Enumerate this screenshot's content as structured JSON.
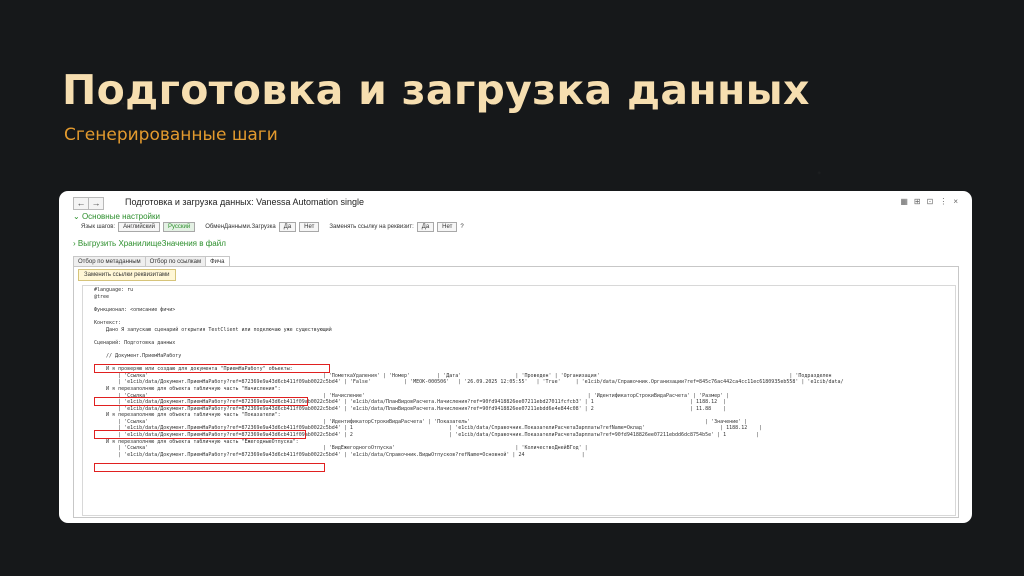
{
  "slide": {
    "title": "Подготовка и загрузка данных",
    "subtitle": "Сгенерированные шаги"
  },
  "window": {
    "title": "Подготовка и загрузка данных: Vanessa Automation single",
    "nav_back": "←",
    "nav_forward": "→",
    "icons": [
      "▦",
      "⊞",
      "⊡",
      "⋮",
      "×"
    ]
  },
  "settings": {
    "toggle": "Основные настройки",
    "lang_label": "Язык шагов:",
    "lang_en": "Английский",
    "lang_ru": "Русский",
    "exchange_label": "ОбменДанными.Загрузка",
    "yes": "Да",
    "no": "Нет",
    "replace_label": "Заменять ссылку на реквизит:",
    "help": "?"
  },
  "export_toggle": "Выгрузить ХранилищеЗначения в файл",
  "tabs": [
    "Отбор по метаданным",
    "Отбор по ссылкам",
    "Фича"
  ],
  "replace_button": "Заменить ссылки реквизитами",
  "code_lines": [
    "#language: ru",
    "@tree",
    "",
    "Функционал: <описание фичи>",
    "",
    "Контекст:",
    "    Дано Я запускаю сценарий открытия TestClient или подключаю уже существующий",
    "",
    "Сценарий: Подготовка данных",
    "",
    "    // Документ.ПриемНаРаботу",
    "",
    "    И я проверяю или создаю для документа \"ПриемНаРаботу\" объекты:",
    "        | 'Ссылка'                                                          | 'ПометкаУдаления' | 'Номер'         | 'Дата'                  | 'Проведен' | 'Организация'                                                               | 'Подразделен",
    "        | 'e1cib/data/Документ.ПриемНаРаботу?ref=872369e9a43d6cb411f09ab0022c5bd4' | 'False'           | 'МЕОК-000506'   | '26.09.2025 12:05:55'   | 'True'     | 'e1cib/data/Справочник.Организации?ref=845c76ac442ca4cc11ec6180935eb558' | 'e1cib/data/",
    "    И я перезаполняю для объекта табличную часть \"Начисления\":",
    "        | 'Ссылка'                                                          | 'Начисление'                                                                          | 'ИдентификаторСтрокиВидаРасчета' | 'Размер' |",
    "        | 'e1cib/data/Документ.ПриемНаРаботу?ref=872369e9a43d6cb411f09ab0022c5bd4' | 'e1cib/data/ПланВидовРасчета.Начисления?ref=90fd9418826ee07211ebd27011fcfcb3' | 1                                | 1188.12  |",
    "        | 'e1cib/data/Документ.ПриемНаРаботу?ref=872369e9a43d6cb411f09ab0022c5bd4' | 'e1cib/data/ПланВидовРасчета.Начисления?ref=90fd9418826ee07211ebdd6e4e844c08' | 2                                | 11.88    |",
    "    И я перезаполняю для объекта табличную часть \"Показатели\":",
    "        | 'Ссылка'                                                          | 'ИдентификаторСтрокиВидаРасчета' | 'Показатель'                                                                              | 'Значение' |",
    "        | 'e1cib/data/Документ.ПриемНаРаботу?ref=872369e9a43d6cb411f09ab0022c5bd4' | 1                                | 'e1cib/data/Справочник.ПоказателиРасчетаЗарплаты?refName=Оклад'                         | 1188.12    |",
    "        | 'e1cib/data/Документ.ПриемНаРаботу?ref=872369e9a43d6cb411f09ab0022c5bd4' | 2                                | 'e1cib/data/Справочник.ПоказателиРасчетаЗарплаты?ref=90fd9418826ee07211ebdd6dc8754b5e' | 1          |",
    "    И я перезаполняю для объекта табличную часть \"ЕжегодныеОтпуска\":",
    "        | 'Ссылка'                                                          | 'ВидЕжегодногоОтпуска'                                        | 'КоличествоДнейВГод' |",
    "        | 'e1cib/data/Документ.ПриемНаРаботу?ref=872369e9a43d6cb411f09ab0022c5bd4' | 'e1cib/data/Справочник.ВидыОтпусков?refName=Основной' | 24                   |"
  ]
}
